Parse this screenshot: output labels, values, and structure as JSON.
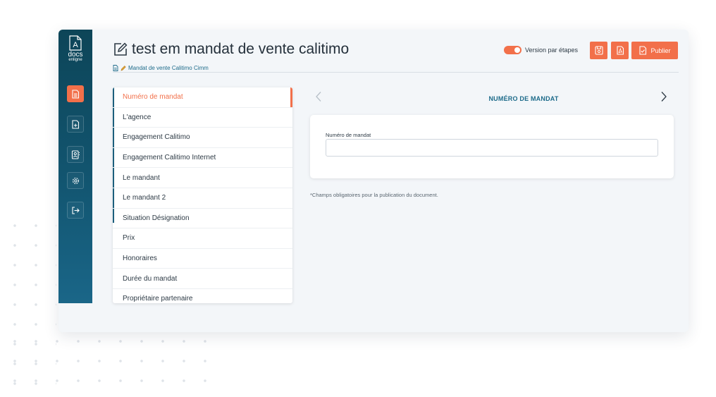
{
  "app": {
    "logo": {
      "letter": "A",
      "line1": "docs",
      "line2": "enligne"
    },
    "title": "test em mandat de vente calitimo",
    "subtitle": "Mandat de vente Calitimo Cimm",
    "accent_color": "#f2704a",
    "sidebar_color": "#125570"
  },
  "sidebar": {
    "items": [
      {
        "icon": "document-icon",
        "active": true
      },
      {
        "icon": "add-document-icon",
        "active": false
      },
      {
        "icon": "contact-book-icon",
        "active": false
      },
      {
        "icon": "gear-icon",
        "active": false
      },
      {
        "icon": "logout-icon",
        "active": false
      }
    ]
  },
  "toolbar": {
    "toggle_label": "Version par étapes",
    "toggle_on": true,
    "save_icon": "save-icon",
    "pdf_icon": "pdf-icon",
    "publish_label": "Publier"
  },
  "steps": {
    "active_index": 0,
    "items": [
      "Numéro de mandat",
      "L'agence",
      "Engagement Calitimo",
      "Engagement Calitimo Internet",
      "Le mandant",
      "Le mandant 2",
      "Situation Désignation",
      "Prix",
      "Honoraires",
      "Durée du mandat",
      "Propriétaire partenaire"
    ]
  },
  "form": {
    "section_title": "NUMÉRO DE MANDAT",
    "field_label": "Numéro de mandat",
    "field_value": "",
    "note": "*Champs obligatoires pour la publication du document."
  }
}
